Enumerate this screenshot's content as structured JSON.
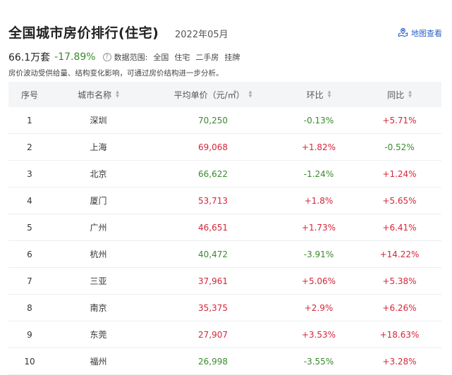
{
  "header": {
    "title": "全国城市房价排行(住宅)",
    "date": "2022年05月",
    "map_button": "地图查看"
  },
  "summary": {
    "price": "66.1万套",
    "change": "-17.89%",
    "scope_label": "数据范围:",
    "scope_items": [
      "全国",
      "住宅",
      "二手房",
      "挂牌"
    ],
    "note": "房价波动受供给量、结构变化影响，可通过房价结构进一步分析。"
  },
  "table": {
    "headers": [
      "序号",
      "城市名称",
      "平均单价（元/㎡）",
      "环比",
      "同比"
    ],
    "rows": [
      {
        "rank": "1",
        "city": "深圳",
        "price": "70,250",
        "mom": "-0.13%",
        "yoy": "+5.71%",
        "price_color": "green",
        "mom_color": "green",
        "yoy_color": "red"
      },
      {
        "rank": "2",
        "city": "上海",
        "price": "69,068",
        "mom": "+1.82%",
        "yoy": "-0.52%",
        "price_color": "red",
        "mom_color": "red",
        "yoy_color": "green"
      },
      {
        "rank": "3",
        "city": "北京",
        "price": "66,622",
        "mom": "-1.24%",
        "yoy": "+1.24%",
        "price_color": "green",
        "mom_color": "green",
        "yoy_color": "red"
      },
      {
        "rank": "4",
        "city": "厦门",
        "price": "53,713",
        "mom": "+1.8%",
        "yoy": "+5.65%",
        "price_color": "red",
        "mom_color": "red",
        "yoy_color": "red"
      },
      {
        "rank": "5",
        "city": "广州",
        "price": "46,651",
        "mom": "+1.73%",
        "yoy": "+6.41%",
        "price_color": "red",
        "mom_color": "red",
        "yoy_color": "red"
      },
      {
        "rank": "6",
        "city": "杭州",
        "price": "40,472",
        "mom": "-3.91%",
        "yoy": "+14.22%",
        "price_color": "green",
        "mom_color": "green",
        "yoy_color": "red"
      },
      {
        "rank": "7",
        "city": "三亚",
        "price": "37,961",
        "mom": "+5.06%",
        "yoy": "+5.38%",
        "price_color": "red",
        "mom_color": "red",
        "yoy_color": "red"
      },
      {
        "rank": "8",
        "city": "南京",
        "price": "35,375",
        "mom": "+2.9%",
        "yoy": "+6.26%",
        "price_color": "red",
        "mom_color": "red",
        "yoy_color": "red"
      },
      {
        "rank": "9",
        "city": "东莞",
        "price": "27,907",
        "mom": "+3.53%",
        "yoy": "+18.63%",
        "price_color": "red",
        "mom_color": "red",
        "yoy_color": "red"
      },
      {
        "rank": "10",
        "city": "福州",
        "price": "26,998",
        "mom": "-3.55%",
        "yoy": "+3.28%",
        "price_color": "green",
        "mom_color": "green",
        "yoy_color": "red"
      }
    ]
  },
  "colors": {
    "up": "#d5263a",
    "down": "#3a8a2e",
    "accent": "#2a62c9"
  }
}
